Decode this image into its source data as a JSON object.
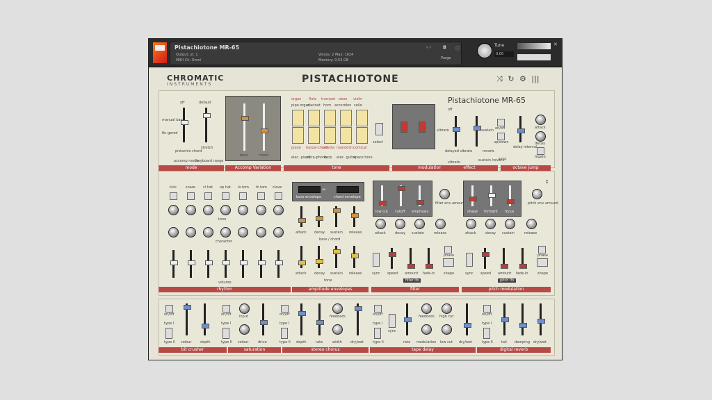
{
  "header": {
    "name": "Pistachiotone MR-65",
    "output": "Output: st. 1",
    "midi": "MIDI Ch: Omni",
    "voices": "Voices: 2   Max: 1024",
    "memory": "Memory: 0.53 GB",
    "purge": "Purge",
    "tune_label": "Tune",
    "tune_value": "0.00"
  },
  "brand": {
    "line1": "CHROMATIC",
    "line2": "INSTRUMENTS"
  },
  "title": "PISTACHIOTONE",
  "logo_title": "Pistachiotone MR-65",
  "sections": {
    "mode": "mode",
    "accomp": "Accomp Variation",
    "tone": "tone",
    "modulation": "modulation",
    "effect": "effect",
    "octave": "octave jump",
    "rhythm": "rhythm",
    "ampenv": "amplitude envelopes",
    "filter": "filter",
    "pitchmod": "pitch modulation",
    "bit": "bit crusher",
    "saturation": "saturation",
    "chorus": "stereo chorus",
    "tape": "tape delay",
    "reverb": "digital reverb"
  },
  "mode_labels": [
    "manual bass",
    "fin-gered",
    "off",
    "pistachio chord",
    "accomp mode",
    "default",
    "stretch",
    "keyboard range"
  ],
  "accomp_labels": [
    "bass",
    "chord"
  ],
  "tone_top": [
    "organ",
    "flute",
    "trumpet",
    "oboe",
    "violin"
  ],
  "tone_mid": [
    "pipe organ",
    "clarinet",
    "horn",
    "accordion",
    "cello"
  ],
  "tone_low": [
    "piano",
    "harpsi-chord",
    "celesta",
    "mandolin",
    "comical"
  ],
  "tone_bottom": [
    "elec. piano",
    "vibra-phone",
    "harp",
    "elec. guitar",
    "space tone"
  ],
  "select_label": "select",
  "effect_labels": [
    "off",
    "vibrato",
    "delayed vibrato",
    "vibrato",
    "sustain",
    "reverb.",
    "sustain /reverb"
  ],
  "octave_labels": [
    "on/off",
    "up/down",
    "sync",
    "delay interval",
    "attack",
    "decay",
    "legato"
  ],
  "drums": [
    "kick",
    "snare",
    "cl hat",
    "op hat",
    "lo tom",
    "hi tom",
    "clave"
  ],
  "rhythm_rows": [
    "tone",
    "character",
    "volume"
  ],
  "env_tabs": [
    "bass envelope",
    "chord envelope"
  ],
  "env_labels": [
    "attack",
    "decay",
    "sustain",
    "release"
  ],
  "env_rows": [
    "bass / chord",
    "tone"
  ],
  "filter_top": [
    "low cut",
    "cutoff",
    "emphasis",
    "filter env amount"
  ],
  "filter_lfo": [
    "sync",
    "speed",
    "amount",
    "fade-in",
    "phase",
    "shape"
  ],
  "filter_lfo_bar": "filter lfo",
  "pitch_top": [
    "shape",
    "formant",
    "focus",
    "pitch env amount"
  ],
  "pitch_lfo_bar": "pitch lfo",
  "fx_bit": [
    "on/off",
    "type I",
    "type II",
    "colour",
    "depth"
  ],
  "fx_sat": [
    "on/off",
    "type I",
    "type II",
    "input",
    "colour",
    "drive"
  ],
  "fx_chorus": [
    "on/off",
    "type I",
    "type II",
    "depth",
    "rate",
    "feedback",
    "width",
    "dry/wet"
  ],
  "fx_tape": [
    "on/off",
    "type I",
    "type II",
    "sync",
    "rate",
    "feedback",
    "modulation",
    "high cut",
    "low cut",
    "dry/wet"
  ],
  "fx_reverb": [
    "on/off",
    "type I",
    "type II",
    "tail",
    "damping",
    "dry/wet"
  ]
}
